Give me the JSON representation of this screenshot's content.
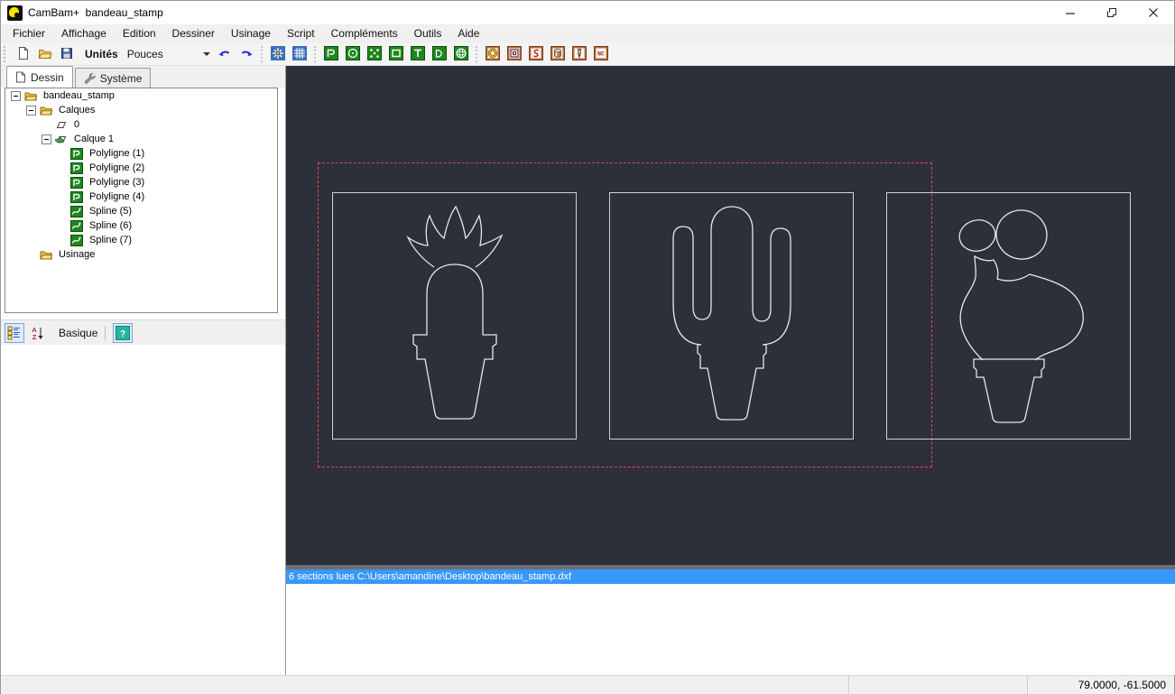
{
  "window": {
    "title": "CamBam+  bandeau_stamp",
    "controls": [
      {
        "name": "minimize-icon"
      },
      {
        "name": "maximize-icon"
      },
      {
        "name": "close-icon"
      }
    ]
  },
  "menu": {
    "items": [
      "Fichier",
      "Affichage",
      "Edition",
      "Dessiner",
      "Usinage",
      "Script",
      "Compléments",
      "Outils",
      "Aide"
    ]
  },
  "toolbar": {
    "units_label": "Unités",
    "units_value": "Pouces",
    "file_icons": [
      {
        "name": "new-file-icon"
      },
      {
        "name": "open-folder-icon"
      },
      {
        "name": "save-icon"
      }
    ],
    "edit_icons": [
      {
        "name": "undo-icon"
      },
      {
        "name": "redo-icon"
      }
    ],
    "view_icons": [
      {
        "name": "snap-points-icon"
      },
      {
        "name": "grid-icon"
      }
    ],
    "draw_icons": [
      {
        "name": "polyline-icon"
      },
      {
        "name": "circle-icon"
      },
      {
        "name": "points-icon"
      },
      {
        "name": "rectangle-icon"
      },
      {
        "name": "text-icon"
      },
      {
        "name": "arc-icon"
      },
      {
        "name": "surface-icon"
      }
    ],
    "machining_icons": [
      {
        "name": "profile-op-icon"
      },
      {
        "name": "pocket-op-icon"
      },
      {
        "name": "engrave-op-icon"
      },
      {
        "name": "drill-op-icon"
      },
      {
        "name": "profile3d-op-icon"
      },
      {
        "name": "gcode-op-icon"
      }
    ]
  },
  "sidebar": {
    "tabs": [
      {
        "label": "Dessin",
        "active": true
      },
      {
        "label": "Système",
        "active": false
      }
    ],
    "tree": [
      {
        "label": "bandeau_stamp",
        "icon": "folder-icon",
        "level": 0,
        "expander": true
      },
      {
        "label": "Calques",
        "icon": "folder-icon",
        "level": 1,
        "expander": true
      },
      {
        "label": "0",
        "icon": "layer-icon",
        "level": 2,
        "expander": false
      },
      {
        "label": "Calque 1",
        "icon": "layer-active-icon",
        "level": 2,
        "expander": true
      },
      {
        "label": "Polyligne (1)",
        "icon": "polyline-obj-icon",
        "level": 3,
        "expander": false
      },
      {
        "label": "Polyligne (2)",
        "icon": "polyline-obj-icon",
        "level": 3,
        "expander": false
      },
      {
        "label": "Polyligne (3)",
        "icon": "polyline-obj-icon",
        "level": 3,
        "expander": false
      },
      {
        "label": "Polyligne (4)",
        "icon": "polyline-obj-icon",
        "level": 3,
        "expander": false
      },
      {
        "label": "Spline (5)",
        "icon": "spline-obj-icon",
        "level": 3,
        "expander": false
      },
      {
        "label": "Spline (6)",
        "icon": "spline-obj-icon",
        "level": 3,
        "expander": false
      },
      {
        "label": "Spline (7)",
        "icon": "spline-obj-icon",
        "level": 3,
        "expander": false
      },
      {
        "label": "Usinage",
        "icon": "folder-icon",
        "level": 1,
        "expander": false
      }
    ],
    "properties_toolbar": {
      "view_label": "Basique",
      "help_label": "?"
    }
  },
  "canvas": {
    "background_color": "#2d2f3a",
    "outline_color": "#e6e7ea",
    "selection_color": "#ee4253",
    "shapes": [
      "cactus-columnar-outline",
      "cactus-saguaro-outline",
      "cactus-prickly-pear-outline"
    ]
  },
  "log": {
    "selected_line": "6 sections lues C:\\Users\\amandine\\Desktop\\bandeau_stamp.dxf"
  },
  "statusbar": {
    "coordinates": "79.0000, -61.5000"
  }
}
